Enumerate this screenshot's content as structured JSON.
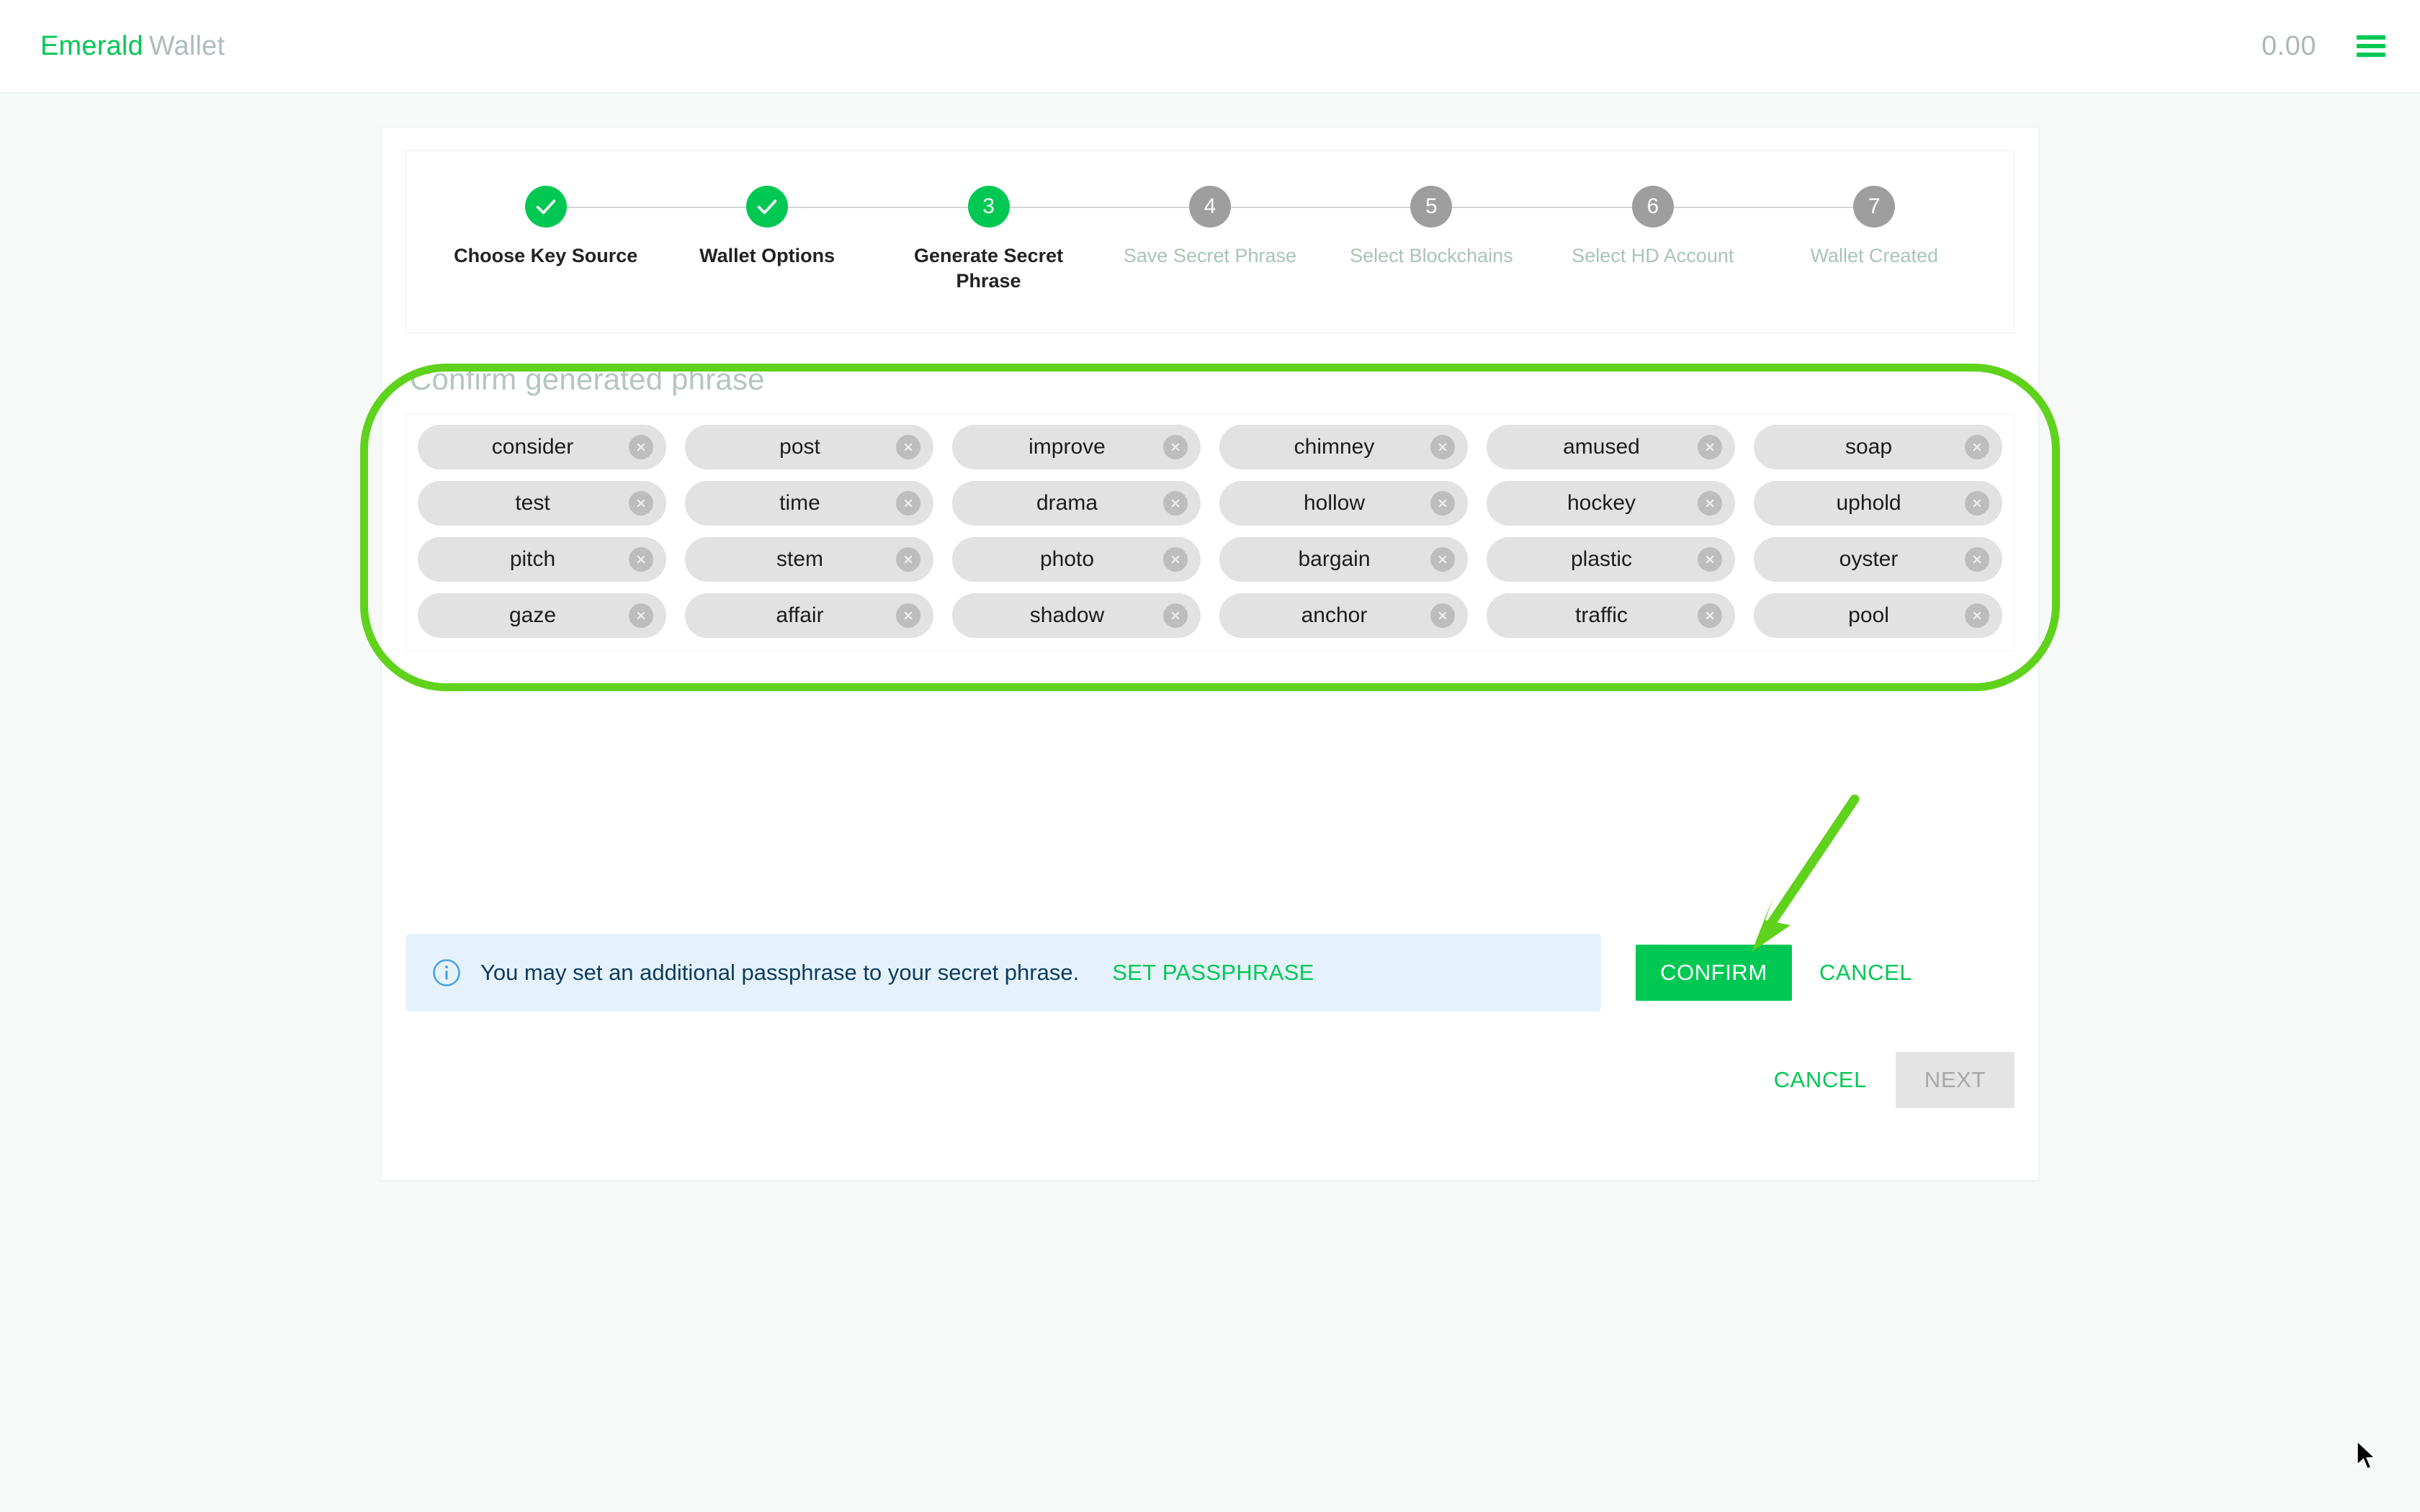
{
  "header": {
    "brand_primary": "Emerald",
    "brand_secondary": "Wallet",
    "balance": "0.00",
    "menu_icon": "hamburger-icon"
  },
  "colors": {
    "brand_green": "#00c853",
    "annotation_green": "#5fd21c",
    "step_inactive": "#9e9e9e",
    "chip_bg": "#e2e2e2",
    "info_bg": "#e6f2fb",
    "info_text": "#0d3c61"
  },
  "stepper": {
    "steps": [
      {
        "number": "1",
        "label": "Choose Key Source",
        "state": "done",
        "glyph": "check-icon"
      },
      {
        "number": "2",
        "label": "Wallet Options",
        "state": "done",
        "glyph": "check-icon"
      },
      {
        "number": "3",
        "label": "Generate Secret Phrase",
        "state": "active",
        "glyph": "3"
      },
      {
        "number": "4",
        "label": "Save Secret Phrase",
        "state": "future",
        "glyph": "4"
      },
      {
        "number": "5",
        "label": "Select Blockchains",
        "state": "future",
        "glyph": "5"
      },
      {
        "number": "6",
        "label": "Select HD Account",
        "state": "future",
        "glyph": "6"
      },
      {
        "number": "7",
        "label": "Wallet Created",
        "state": "future",
        "glyph": "7"
      }
    ]
  },
  "phrase": {
    "title": "Confirm generated phrase",
    "rows": [
      [
        "consider",
        "post",
        "improve",
        "chimney",
        "amused",
        "soap"
      ],
      [
        "test",
        "time",
        "drama",
        "hollow",
        "hockey",
        "uphold"
      ],
      [
        "pitch",
        "stem",
        "photo",
        "bargain",
        "plastic",
        "oyster"
      ],
      [
        "gaze",
        "affair",
        "shadow",
        "anchor",
        "traffic",
        "pool"
      ]
    ],
    "remove_icon": "close-circle-icon"
  },
  "passphrase": {
    "info_icon": "info-icon",
    "message": "You may set an additional passphrase to your secret phrase.",
    "link_label": "SET PASSPHRASE",
    "confirm_label": "CONFIRM",
    "cancel_label": "CANCEL"
  },
  "bottom": {
    "cancel_label": "CANCEL",
    "next_label": "NEXT"
  }
}
